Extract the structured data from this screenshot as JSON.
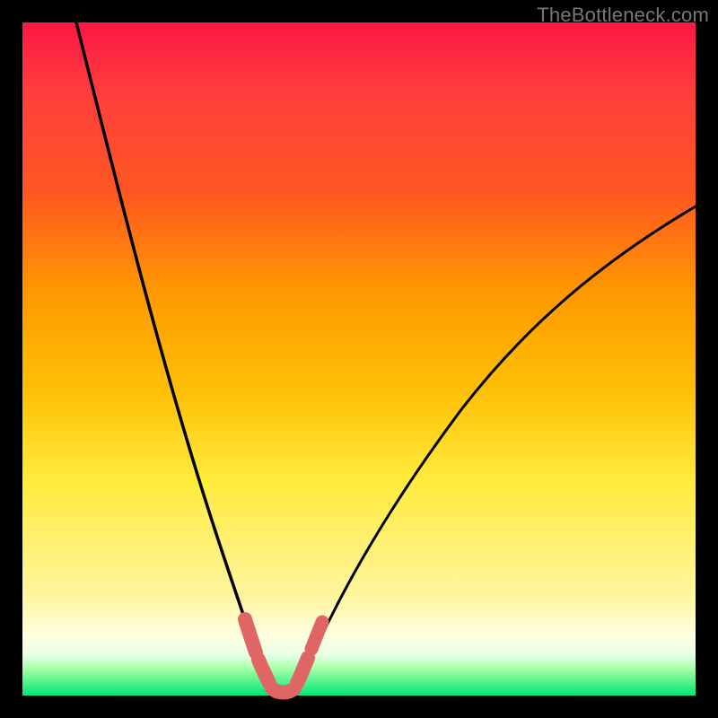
{
  "watermark": "TheBottleneck.com",
  "colors": {
    "background": "#000000",
    "curve": "#000000",
    "highlight": "#e06666",
    "gradient_top": "#ff1744",
    "gradient_bottom": "#00e676"
  },
  "chart_data": {
    "type": "line",
    "title": "",
    "xlabel": "",
    "ylabel": "",
    "xlim": [
      0,
      100
    ],
    "ylim": [
      0,
      100
    ],
    "axes_visible": false,
    "grid": false,
    "legend": false,
    "annotations": [],
    "series": [
      {
        "name": "left-curve",
        "x": [
          8,
          12,
          16,
          20,
          24,
          27,
          30,
          32,
          34,
          35,
          36,
          37
        ],
        "y": [
          100,
          85,
          70,
          55,
          40,
          28,
          18,
          12,
          7,
          4,
          2,
          0
        ]
      },
      {
        "name": "right-curve",
        "x": [
          40,
          41,
          43,
          45,
          48,
          52,
          57,
          63,
          70,
          78,
          87,
          97,
          100
        ],
        "y": [
          0,
          2,
          5,
          9,
          15,
          22,
          30,
          38,
          46,
          54,
          62,
          70,
          72
        ]
      },
      {
        "name": "valley-floor",
        "x": [
          37,
          38,
          39,
          40
        ],
        "y": [
          0,
          0,
          0,
          0
        ]
      }
    ],
    "highlight_segments": [
      {
        "on_series": "left-curve",
        "x_range": [
          32,
          37
        ],
        "note": "near-bottom left slope"
      },
      {
        "on_series": "right-curve",
        "x_range": [
          40,
          45
        ],
        "note": "near-bottom right slope"
      },
      {
        "on_series": "valley-floor",
        "x_range": [
          37,
          40
        ],
        "note": "trough"
      }
    ]
  }
}
